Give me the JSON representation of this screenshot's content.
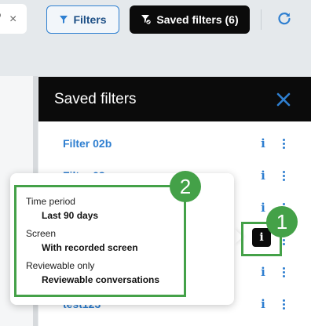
{
  "toolbar": {
    "search_fragment": "o",
    "clear_symbol": "×",
    "filters_label": "Filters",
    "saved_filters_label": "Saved filters (6)"
  },
  "panel": {
    "title": "Saved filters",
    "rows": [
      {
        "name": "Filter 02b"
      },
      {
        "name": "Filter 03"
      },
      {
        "name": ""
      },
      {
        "name": ""
      },
      {
        "name": ""
      },
      {
        "name": "test123"
      }
    ]
  },
  "popover": {
    "fields": [
      {
        "label": "Time period",
        "value": "Last 90 days"
      },
      {
        "label": "Screen",
        "value": "With recorded screen"
      },
      {
        "label": "Reviewable only",
        "value": "Reviewable conversations"
      }
    ],
    "info_glyph": "i"
  },
  "annotations": {
    "badge_1": "1",
    "badge_2": "2",
    "color": "#44a148"
  },
  "colors": {
    "accent_blue": "#2f7fd0",
    "dark": "#0b0b0b"
  }
}
